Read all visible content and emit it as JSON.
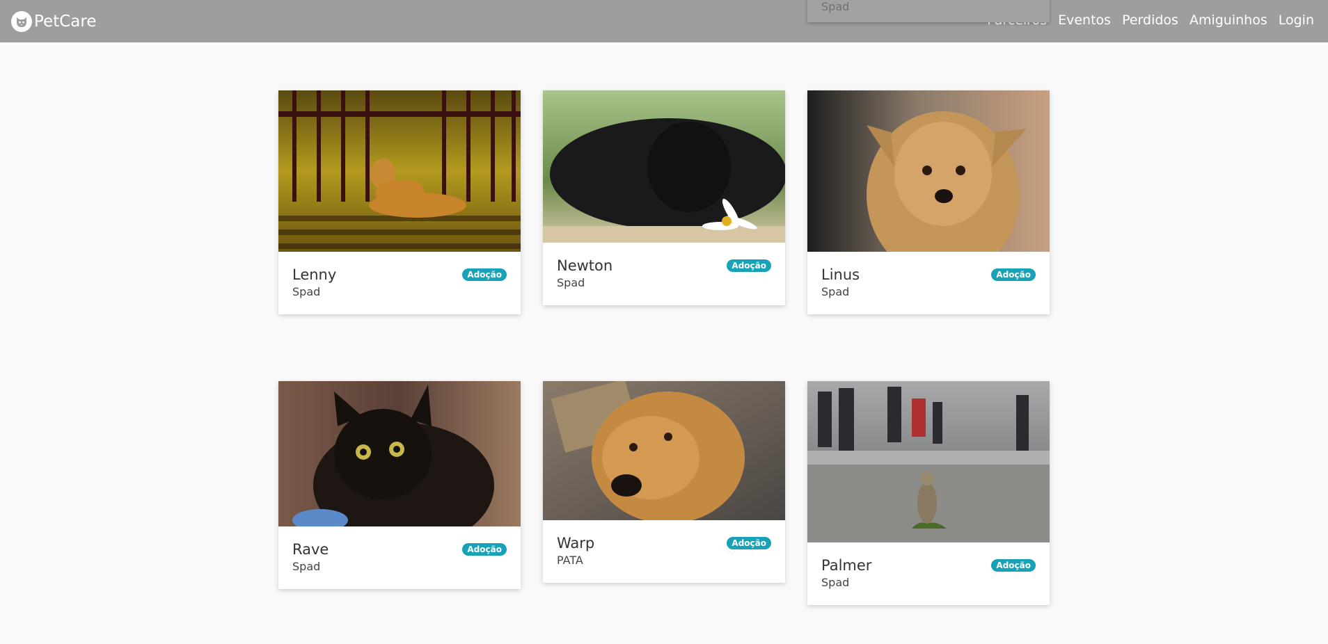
{
  "brand": {
    "name": "PetCare"
  },
  "nav": [
    "Parceiros",
    "Eventos",
    "Perdidos",
    "Amiguinhos",
    "Login"
  ],
  "peek_card": {
    "org": "Spad"
  },
  "badge_color": "#17a2b8",
  "navbar_color": "#9e9e9e",
  "cards": [
    {
      "name": "Lenny",
      "org": "Spad",
      "badge": "Adoção",
      "photo": "dog lying behind iron gate at sunset"
    },
    {
      "name": "Newton",
      "org": "Spad",
      "badge": "Adoção",
      "photo": "black dog resting with a daisy"
    },
    {
      "name": "Linus",
      "org": "Spad",
      "badge": "Adoção",
      "photo": "scruffy tan terrier portrait"
    },
    {
      "name": "Rave",
      "org": "Spad",
      "badge": "Adoção",
      "photo": "fluffy black cat with yellow eyes"
    },
    {
      "name": "Warp",
      "org": "PATA",
      "badge": "Adoção",
      "photo": "brown dog looking up"
    },
    {
      "name": "Palmer",
      "org": "Spad",
      "badge": "Adoção",
      "photo": "tabby cat sitting on a street"
    }
  ]
}
